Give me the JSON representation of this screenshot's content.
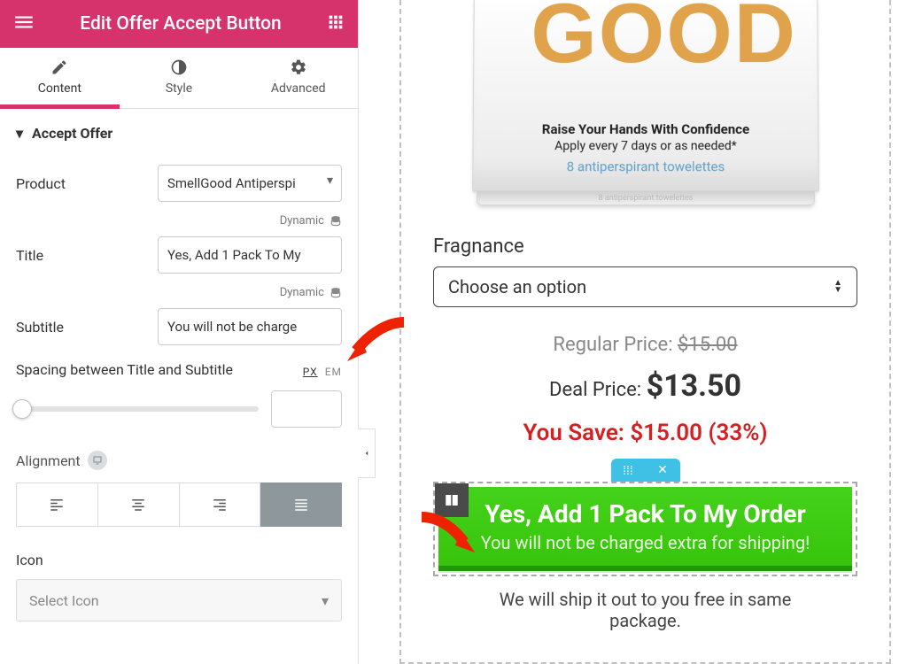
{
  "header": {
    "title": "Edit Offer Accept Button"
  },
  "tabs": {
    "content": "Content",
    "style": "Style",
    "advanced": "Advanced",
    "active": "content"
  },
  "section": {
    "title": "Accept Offer"
  },
  "fields": {
    "product_label": "Product",
    "product_value": "SmellGood Antiperspi",
    "title_label": "Title",
    "title_value": "Yes, Add 1 Pack To My",
    "subtitle_label": "Subtitle",
    "subtitle_value": "You will not be charge",
    "dynamic": "Dynamic",
    "spacing_label": "Spacing between Title and Subtitle",
    "units": {
      "px": "PX",
      "em": "EM"
    },
    "alignment_label": "Alignment",
    "icon_label": "Icon",
    "icon_placeholder": "Select Icon"
  },
  "preview": {
    "brand": "GOOD",
    "confidence1": "Raise Your Hands With Confidence",
    "confidence2": "Apply every 7 days or as needed*",
    "confidence3": "8 antiperspirant towelettes",
    "fragrance_label": "Fragnance",
    "fragrance_placeholder": "Choose an option",
    "regular_label": "Regular Price: ",
    "regular_value": "$15.00",
    "deal_label": "Deal Price: ",
    "deal_value": "$13.50",
    "save_text": "You Save: $15.00 (33%)",
    "cta_title": "Yes, Add 1 Pack To My Order",
    "cta_sub": "You will not be charged extra for shipping!",
    "ship_note": "We will ship it out to you free in same package."
  },
  "colors": {
    "accent": "#d6336c",
    "cta": "#37c40b",
    "save": "#d42020"
  }
}
